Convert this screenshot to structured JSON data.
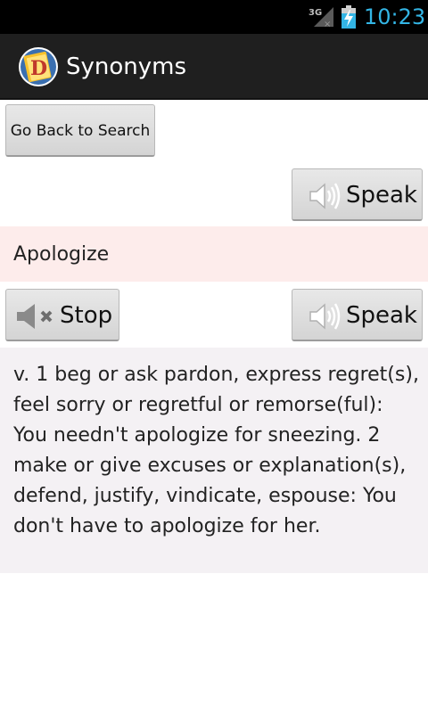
{
  "status_bar": {
    "network": "3G",
    "time": "10:23"
  },
  "action_bar": {
    "title": "Synonyms",
    "icon": "dictionary-book-icon"
  },
  "buttons": {
    "back_label": "Go Back to Search",
    "speak_label": "Speak",
    "stop_label": "Stop"
  },
  "entry": {
    "word": "Apologize",
    "definition": "v. 1 beg or ask pardon, express regret(s), feel sorry or regretful or remorse(ful): You needn't apologize for sneezing. 2 make or give excuses or explanation(s), defend, justify, vindicate, espouse: You don't have to apologize for her."
  },
  "colors": {
    "status_clock": "#33b5e5",
    "action_bar_bg": "#1f1f1f",
    "word_band_bg": "#fdeceb",
    "definition_bg": "#f4f1f4"
  }
}
